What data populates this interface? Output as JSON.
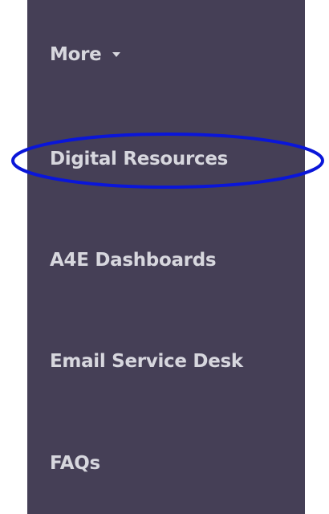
{
  "menu": {
    "more": {
      "label": "More",
      "icon": "caret-down-icon"
    },
    "items": [
      {
        "label": "Digital Resources",
        "highlighted": true
      },
      {
        "label": "A4E Dashboards"
      },
      {
        "label": "Email Service Desk"
      },
      {
        "label": "FAQs"
      }
    ]
  },
  "colors": {
    "panel_background": "#453f56",
    "text": "#d7d7de",
    "highlight_ring": "#0a16d9"
  }
}
